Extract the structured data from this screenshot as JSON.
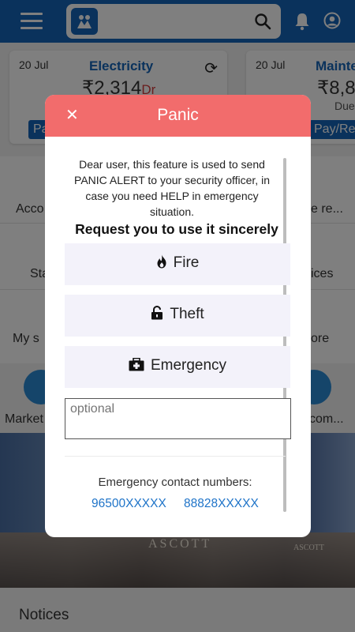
{
  "background": {
    "cards": [
      {
        "date": "20 Jul",
        "title": "Electricity",
        "amount": "₹2,314",
        "suffix": "Dr",
        "button": "Pay/Re"
      },
      {
        "date": "20 Jul",
        "title": "Mainte",
        "amount": "₹8,8",
        "due": "Due",
        "button": "Pay/Re"
      }
    ],
    "grid_labels": [
      "Acco",
      "e re...",
      "Sta",
      "ices",
      "My s",
      "ore",
      "Market",
      "com..."
    ],
    "banner_text": "ASCOTT",
    "banner_text_small": "ASCOTT",
    "notices": "Notices"
  },
  "modal": {
    "title": "Panic",
    "close_icon": "✕",
    "message": "Dear user, this feature is used to send PANIC ALERT to your security officer, in case you need HELP in emergency situation.",
    "emphasis": "Request you to use it sincerely",
    "options": [
      {
        "label": "Fire",
        "icon": "fire-icon"
      },
      {
        "label": "Theft",
        "icon": "lock-icon"
      },
      {
        "label": "Emergency",
        "icon": "first-aid-icon"
      }
    ],
    "textarea_placeholder": "optional",
    "contact_title": "Emergency contact numbers:",
    "phones": [
      "96500XXXXX",
      "88828XXXXX"
    ]
  },
  "colors": {
    "header_blue": "#1565b8",
    "modal_header": "#f26c6c",
    "link": "#1e73c8",
    "option_bg": "#f3f2fa"
  }
}
